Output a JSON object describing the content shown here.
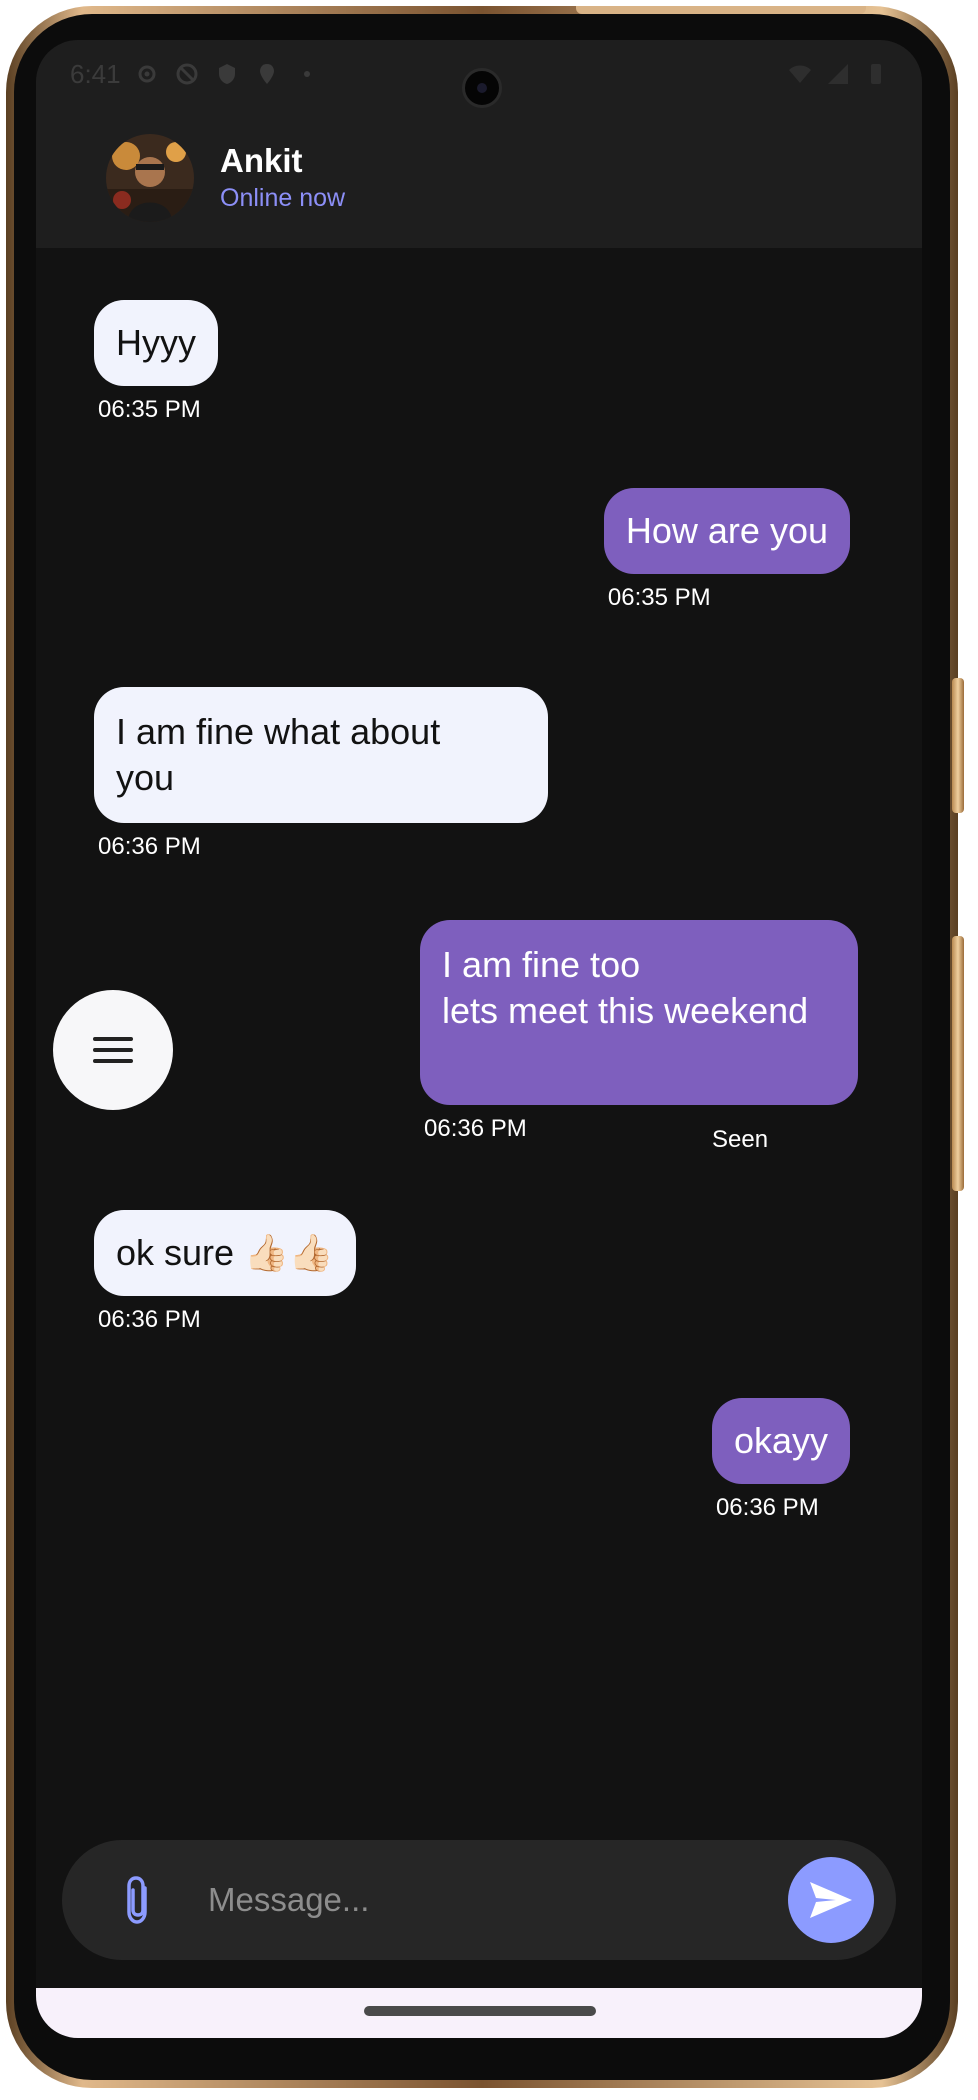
{
  "status_bar": {
    "time": "6:41"
  },
  "header": {
    "contact_name": "Ankit",
    "contact_status": "Online now"
  },
  "messages": [
    {
      "direction": "incoming",
      "text": "Hyyy",
      "time": "06:35 PM"
    },
    {
      "direction": "outgoing",
      "text": "How are you",
      "time": "06:35 PM"
    },
    {
      "direction": "incoming",
      "text": "I am fine what about\nyou",
      "time": "06:36 PM"
    },
    {
      "direction": "outgoing",
      "text": "I am fine too\nlets meet this weekend",
      "time": "06:36 PM",
      "status": "Seen"
    },
    {
      "direction": "incoming",
      "text": "ok sure 👍🏻👍🏻",
      "time": "06:36 PM"
    },
    {
      "direction": "outgoing",
      "text": "okayy",
      "time": "06:36 PM"
    }
  ],
  "fab": {
    "icon": "menu-icon"
  },
  "composer": {
    "placeholder": "Message...",
    "value": "",
    "attach_icon": "paperclip-icon",
    "send_icon": "send-icon"
  },
  "colors": {
    "background": "#121212",
    "header": "#1e1e1e",
    "incoming_bubble": "#f1f3fd",
    "outgoing_bubble": "#7e5fbe",
    "accent": "#8c9bff",
    "status_accent": "#8c8ff7"
  }
}
